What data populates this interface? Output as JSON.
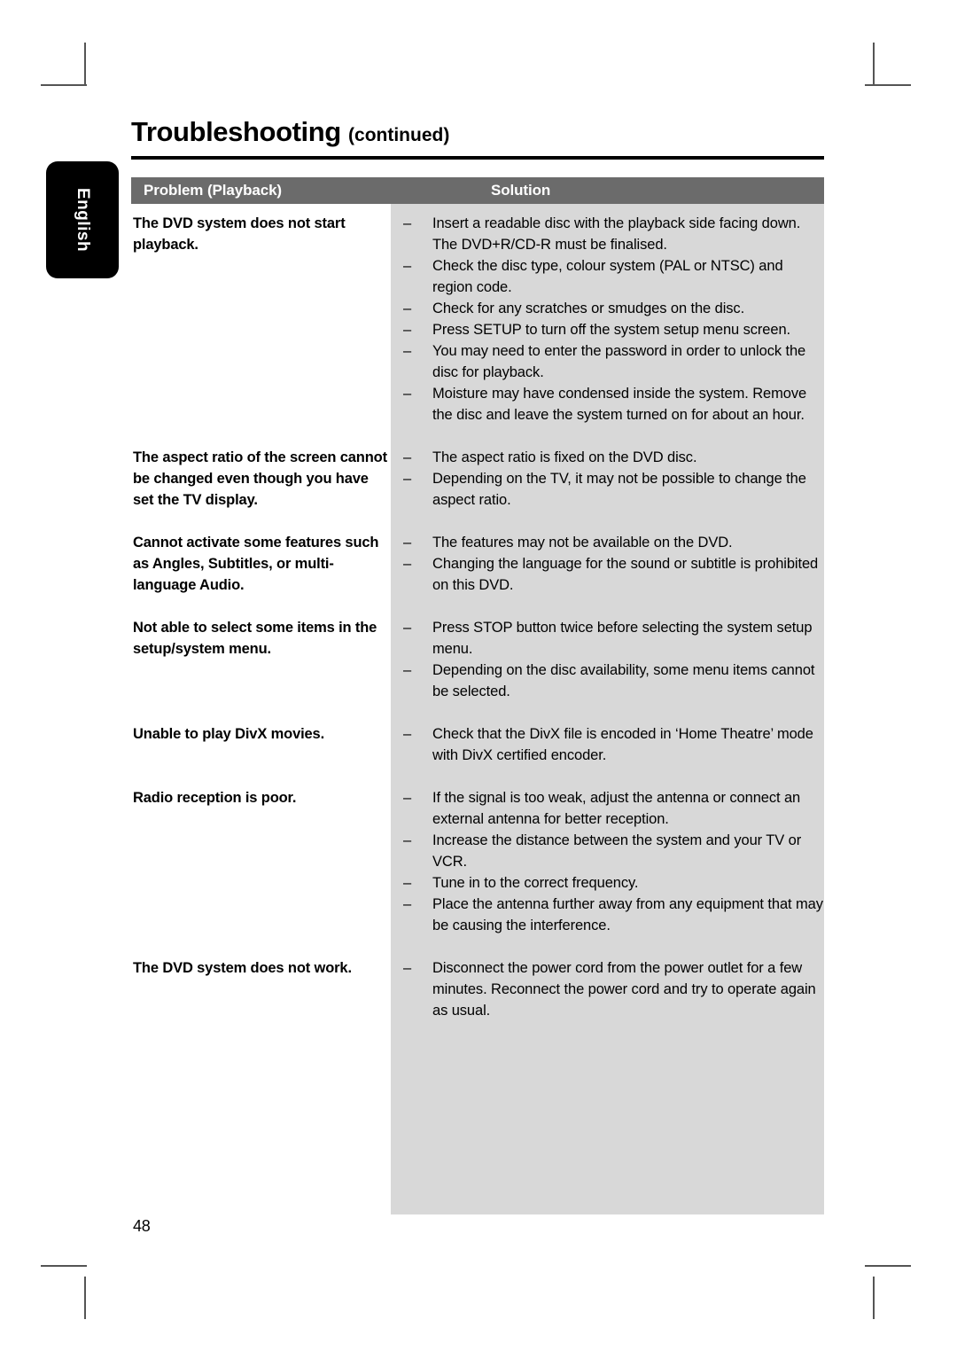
{
  "page": {
    "title": "Troubleshooting",
    "title_suffix": "(continued)",
    "number": "48",
    "language_tab": "English",
    "colors": {
      "header_bar": "#6b6b6b",
      "solution_column": "#d8d8d8",
      "tab": "#000000",
      "text": "#000000"
    }
  },
  "table": {
    "headers": {
      "problem": "Problem (Playback)",
      "solution": "Solution"
    },
    "rows": [
      {
        "problem": "The DVD system does not start playback.",
        "solutions": [
          "Insert a readable disc with the playback side facing down. The DVD+R/CD-R must be finalised.",
          "Check the disc type, colour system (PAL or NTSC) and region code.",
          "Check for any scratches or smudges on the disc.",
          "Press SETUP to turn off the system setup menu screen.",
          "You may need to enter the password in order to unlock the disc for playback.",
          "Moisture may have condensed inside the system. Remove the disc and leave the system turned on for about an hour."
        ]
      },
      {
        "problem": "The aspect ratio of the screen cannot be changed even though you have set the TV display.",
        "solutions": [
          "The aspect ratio is fixed on the DVD disc.",
          "Depending on the TV, it may not be possible to change the aspect ratio."
        ]
      },
      {
        "problem": "Cannot activate some features such as Angles, Subtitles, or multi-language Audio.",
        "solutions": [
          "The features may not be available on the DVD.",
          "Changing the language for the sound or subtitle is prohibited on this DVD."
        ]
      },
      {
        "problem": "Not able to select some items in the setup/system menu.",
        "solutions": [
          "Press STOP button twice before selecting the system setup menu.",
          "Depending on the disc availability, some menu items cannot be selected."
        ]
      },
      {
        "problem": "Unable to play DivX movies.",
        "solutions": [
          "Check that the DivX file is encoded in ‘Home Theatre’ mode with DivX certified encoder."
        ]
      },
      {
        "problem": "Radio reception is poor.",
        "solutions": [
          "If the signal is too weak, adjust the antenna or connect an external antenna for better reception.",
          "Increase the distance between the system and your TV or VCR.",
          "Tune in to the correct frequency.",
          "Place the antenna further away from any equipment that may be causing the interference."
        ]
      },
      {
        "problem": "The DVD system does not work.",
        "solutions": [
          "Disconnect the power cord from the power outlet for a few minutes. Reconnect the power cord and try to operate again as usual."
        ]
      }
    ],
    "bullet_glyph": "–"
  }
}
